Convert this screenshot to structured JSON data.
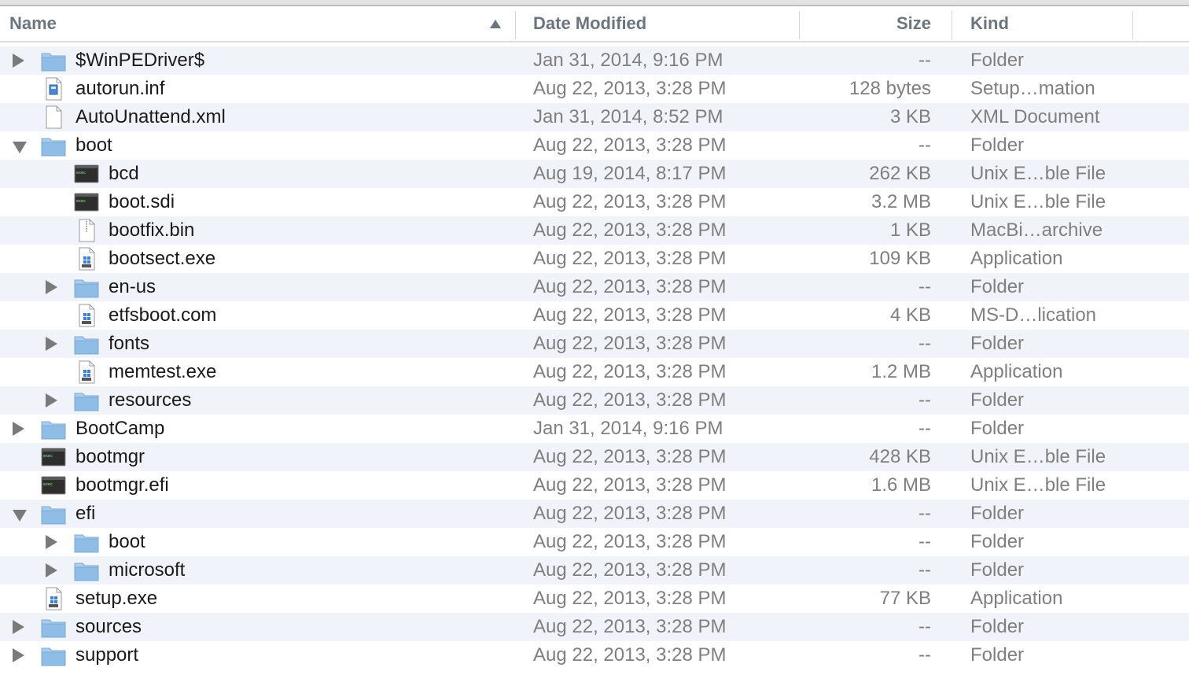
{
  "header": {
    "name_label": "Name",
    "date_label": "Date Modified",
    "size_label": "Size",
    "kind_label": "Kind",
    "sort_column": "Name",
    "sort_direction": "ascending"
  },
  "colors": {
    "alt_row": "#f0f4fa",
    "header_text": "#6b7580",
    "secondary_text": "#7f7f7f",
    "folder_blue": "#8fbde6"
  },
  "rows": [
    {
      "name": "$WinPEDriver$",
      "date": "Jan 31, 2014, 9:16 PM",
      "size": "--",
      "kind": "Folder",
      "depth": 0,
      "icon": "folder-icon",
      "disclosure": "closed"
    },
    {
      "name": "autorun.inf",
      "date": "Aug 22, 2013, 3:28 PM",
      "size": "128 bytes",
      "kind": "Setup…mation",
      "depth": 0,
      "icon": "setup-document-icon",
      "disclosure": "none"
    },
    {
      "name": "AutoUnattend.xml",
      "date": "Jan 31, 2014, 8:52 PM",
      "size": "3 KB",
      "kind": "XML Document",
      "depth": 0,
      "icon": "document-icon",
      "disclosure": "none"
    },
    {
      "name": "boot",
      "date": "Aug 22, 2013, 3:28 PM",
      "size": "--",
      "kind": "Folder",
      "depth": 0,
      "icon": "folder-icon",
      "disclosure": "open"
    },
    {
      "name": "bcd",
      "date": "Aug 19, 2014, 8:17 PM",
      "size": "262 KB",
      "kind": "Unix E…ble File",
      "depth": 1,
      "icon": "terminal-executable-icon",
      "disclosure": "none"
    },
    {
      "name": "boot.sdi",
      "date": "Aug 22, 2013, 3:28 PM",
      "size": "3.2 MB",
      "kind": "Unix E…ble File",
      "depth": 1,
      "icon": "terminal-executable-icon",
      "disclosure": "none"
    },
    {
      "name": "bootfix.bin",
      "date": "Aug 22, 2013, 3:28 PM",
      "size": "1 KB",
      "kind": "MacBi…archive",
      "depth": 1,
      "icon": "binary-archive-icon",
      "disclosure": "none"
    },
    {
      "name": "bootsect.exe",
      "date": "Aug 22, 2013, 3:28 PM",
      "size": "109 KB",
      "kind": "Application",
      "depth": 1,
      "icon": "windows-app-icon",
      "disclosure": "none"
    },
    {
      "name": "en-us",
      "date": "Aug 22, 2013, 3:28 PM",
      "size": "--",
      "kind": "Folder",
      "depth": 1,
      "icon": "folder-icon",
      "disclosure": "closed"
    },
    {
      "name": "etfsboot.com",
      "date": "Aug 22, 2013, 3:28 PM",
      "size": "4 KB",
      "kind": "MS-D…lication",
      "depth": 1,
      "icon": "windows-app-icon",
      "disclosure": "none"
    },
    {
      "name": "fonts",
      "date": "Aug 22, 2013, 3:28 PM",
      "size": "--",
      "kind": "Folder",
      "depth": 1,
      "icon": "folder-icon",
      "disclosure": "closed"
    },
    {
      "name": "memtest.exe",
      "date": "Aug 22, 2013, 3:28 PM",
      "size": "1.2 MB",
      "kind": "Application",
      "depth": 1,
      "icon": "windows-app-icon",
      "disclosure": "none"
    },
    {
      "name": "resources",
      "date": "Aug 22, 2013, 3:28 PM",
      "size": "--",
      "kind": "Folder",
      "depth": 1,
      "icon": "folder-icon",
      "disclosure": "closed"
    },
    {
      "name": "BootCamp",
      "date": "Jan 31, 2014, 9:16 PM",
      "size": "--",
      "kind": "Folder",
      "depth": 0,
      "icon": "folder-icon",
      "disclosure": "closed"
    },
    {
      "name": "bootmgr",
      "date": "Aug 22, 2013, 3:28 PM",
      "size": "428 KB",
      "kind": "Unix E…ble File",
      "depth": 0,
      "icon": "terminal-executable-icon",
      "disclosure": "none"
    },
    {
      "name": "bootmgr.efi",
      "date": "Aug 22, 2013, 3:28 PM",
      "size": "1.6 MB",
      "kind": "Unix E…ble File",
      "depth": 0,
      "icon": "terminal-executable-icon",
      "disclosure": "none"
    },
    {
      "name": "efi",
      "date": "Aug 22, 2013, 3:28 PM",
      "size": "--",
      "kind": "Folder",
      "depth": 0,
      "icon": "folder-icon",
      "disclosure": "open"
    },
    {
      "name": "boot",
      "date": "Aug 22, 2013, 3:28 PM",
      "size": "--",
      "kind": "Folder",
      "depth": 1,
      "icon": "folder-icon",
      "disclosure": "closed"
    },
    {
      "name": "microsoft",
      "date": "Aug 22, 2013, 3:28 PM",
      "size": "--",
      "kind": "Folder",
      "depth": 1,
      "icon": "folder-icon",
      "disclosure": "closed"
    },
    {
      "name": "setup.exe",
      "date": "Aug 22, 2013, 3:28 PM",
      "size": "77 KB",
      "kind": "Application",
      "depth": 0,
      "icon": "windows-app-icon",
      "disclosure": "none"
    },
    {
      "name": "sources",
      "date": "Aug 22, 2013, 3:28 PM",
      "size": "--",
      "kind": "Folder",
      "depth": 0,
      "icon": "folder-icon",
      "disclosure": "closed"
    },
    {
      "name": "support",
      "date": "Aug 22, 2013, 3:28 PM",
      "size": "--",
      "kind": "Folder",
      "depth": 0,
      "icon": "folder-icon",
      "disclosure": "closed"
    }
  ]
}
